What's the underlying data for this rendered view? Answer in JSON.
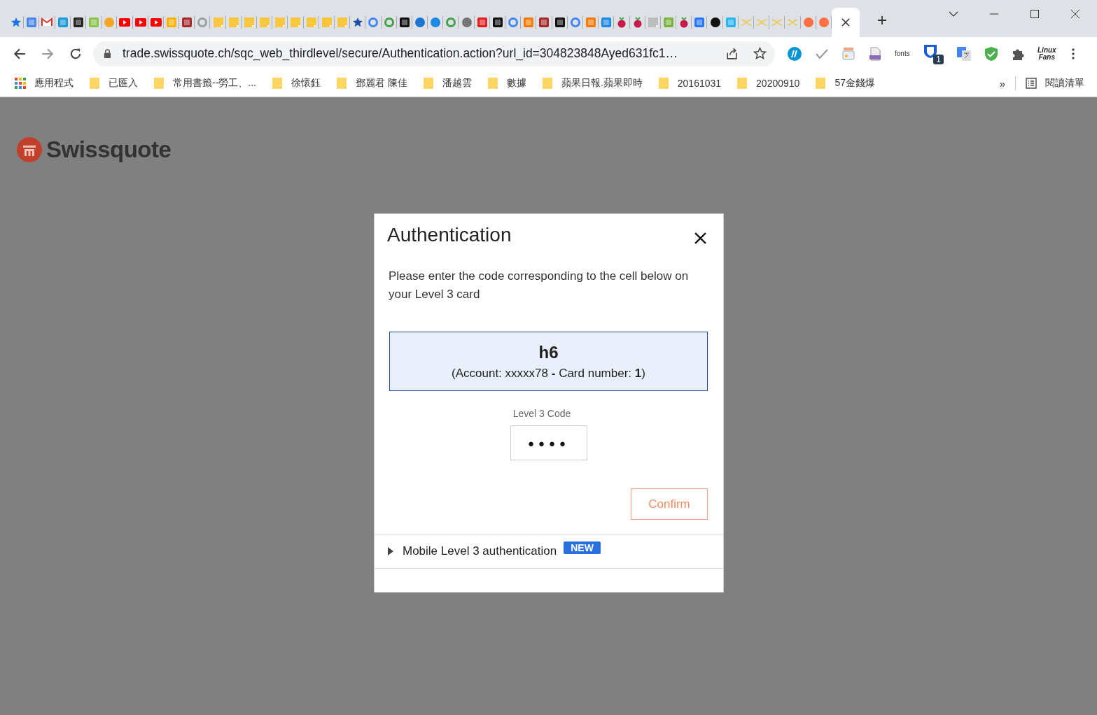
{
  "tabs": [
    {
      "kind": "star",
      "color": "#1a73e8",
      "selected": false
    },
    {
      "kind": "square",
      "color": "#4a86e8",
      "selected": false
    },
    {
      "kind": "mail",
      "color": "#d93025",
      "selected": false
    },
    {
      "kind": "square",
      "color": "#1a9ad6",
      "selected": false
    },
    {
      "kind": "square",
      "color": "#222222",
      "selected": false
    },
    {
      "kind": "square",
      "color": "#8bc34a",
      "selected": false
    },
    {
      "kind": "circle",
      "color": "#f5a623",
      "selected": false
    },
    {
      "kind": "play",
      "color": "#ff0000",
      "selected": false
    },
    {
      "kind": "play",
      "color": "#ff0000",
      "selected": false
    },
    {
      "kind": "play",
      "color": "#ff0000",
      "selected": false
    },
    {
      "kind": "square",
      "color": "#ffb300",
      "selected": false
    },
    {
      "kind": "square",
      "color": "#a52a2a",
      "selected": false
    },
    {
      "kind": "ring",
      "color": "#9e9e9e",
      "selected": false
    },
    {
      "kind": "note",
      "color": "#f9c73d",
      "selected": false
    },
    {
      "kind": "note",
      "color": "#f9c73d",
      "selected": false
    },
    {
      "kind": "note",
      "color": "#f9c73d",
      "selected": false
    },
    {
      "kind": "note",
      "color": "#f9c73d",
      "selected": false
    },
    {
      "kind": "note",
      "color": "#f9c73d",
      "selected": false
    },
    {
      "kind": "note",
      "color": "#f9c73d",
      "selected": false
    },
    {
      "kind": "note",
      "color": "#f9c73d",
      "selected": false
    },
    {
      "kind": "note",
      "color": "#f9c73d",
      "selected": false
    },
    {
      "kind": "note",
      "color": "#f9c73d",
      "selected": false
    },
    {
      "kind": "star",
      "color": "#1e4fa3",
      "selected": false
    },
    {
      "kind": "ring",
      "color": "#4285f4",
      "selected": false
    },
    {
      "kind": "ring",
      "color": "#43a047",
      "selected": false
    },
    {
      "kind": "square",
      "color": "#111111",
      "selected": false
    },
    {
      "kind": "circle",
      "color": "#1976d2",
      "selected": false
    },
    {
      "kind": "circle",
      "color": "#1e88e5",
      "selected": false
    },
    {
      "kind": "ring",
      "color": "#43a047",
      "selected": false
    },
    {
      "kind": "circle",
      "color": "#757575",
      "selected": false
    },
    {
      "kind": "square",
      "color": "#e02020",
      "selected": false
    },
    {
      "kind": "square",
      "color": "#111111",
      "selected": false
    },
    {
      "kind": "ring",
      "color": "#4285f4",
      "selected": false
    },
    {
      "kind": "square",
      "color": "#f57c00",
      "selected": false
    },
    {
      "kind": "square",
      "color": "#a52a2a",
      "selected": false
    },
    {
      "kind": "square",
      "color": "#111111",
      "selected": false
    },
    {
      "kind": "ring",
      "color": "#4285f4",
      "selected": false
    },
    {
      "kind": "square",
      "color": "#f57c00",
      "selected": false
    },
    {
      "kind": "square",
      "color": "#1e88e5",
      "selected": false
    },
    {
      "kind": "berry",
      "color": "#c51a4a",
      "selected": false
    },
    {
      "kind": "berry",
      "color": "#c51a4a",
      "selected": false
    },
    {
      "kind": "note",
      "color": "#bdbdbd",
      "selected": false
    },
    {
      "kind": "square",
      "color": "#7cb342",
      "selected": false
    },
    {
      "kind": "berry",
      "color": "#c51a4a",
      "selected": false
    },
    {
      "kind": "square",
      "color": "#2979ff",
      "selected": false
    },
    {
      "kind": "circle",
      "color": "#111111",
      "selected": false
    },
    {
      "kind": "square",
      "color": "#29b6f6",
      "selected": false
    },
    {
      "kind": "cross",
      "color": "#f4c542",
      "selected": false
    },
    {
      "kind": "cross",
      "color": "#f4c542",
      "selected": false
    },
    {
      "kind": "cross",
      "color": "#f4c542",
      "selected": false
    },
    {
      "kind": "cross",
      "color": "#f4c542",
      "selected": false
    },
    {
      "kind": "circle",
      "color": "#ff7043",
      "selected": false
    },
    {
      "kind": "circle",
      "color": "#ff7043",
      "selected": false
    },
    {
      "kind": "none",
      "selected": true
    }
  ],
  "toolbar": {
    "url": "trade.swissquote.ch/sqc_web_thirdlevel/secure/Authentication.action?url_id=304823848Ayed631fc1…",
    "extensions": [
      {
        "kind": "hp"
      },
      {
        "kind": "check"
      },
      {
        "kind": "doc"
      },
      {
        "kind": "pdf"
      },
      {
        "kind": "text",
        "label": "fonts"
      },
      {
        "kind": "shield-badge",
        "badge": "1"
      },
      {
        "kind": "translate"
      },
      {
        "kind": "shield"
      },
      {
        "kind": "puzzle"
      },
      {
        "kind": "logo",
        "label": "Linux",
        "label_2": "Fans"
      }
    ]
  },
  "bookmarks": [
    {
      "kind": "apps",
      "label": "應用程式"
    },
    {
      "kind": "folder",
      "label": "已匯入"
    },
    {
      "kind": "folder",
      "label": "常用書籤--勞工、..."
    },
    {
      "kind": "folder",
      "label": "徐懷鈺"
    },
    {
      "kind": "folder",
      "label": "鄧麗君 陳佳"
    },
    {
      "kind": "folder",
      "label": "潘越雲"
    },
    {
      "kind": "folder",
      "label": "數據"
    },
    {
      "kind": "folder",
      "label": "蘋果日報.蘋果即時"
    },
    {
      "kind": "folder",
      "label": "20161031"
    },
    {
      "kind": "folder",
      "label": "20200910"
    },
    {
      "kind": "folder",
      "label": "57金錢爆"
    }
  ],
  "bookmarks_more": "»",
  "reading_list": "閱讀清單",
  "logo": "Swissquote",
  "dialog": {
    "title": "Authentication",
    "message": "Please enter the code corresponding to the cell below on your Level 3 card",
    "cell": "h6",
    "card_info": "(Account: xxxxx78 **-** Card number: **1**)",
    "code_label": "Level 3 Code",
    "code_value": "●●●●",
    "confirm": "Confirm",
    "mobile": {
      "label": "Mobile Level 3 authentication",
      "badge": "NEW",
      "expanded": false
    }
  }
}
